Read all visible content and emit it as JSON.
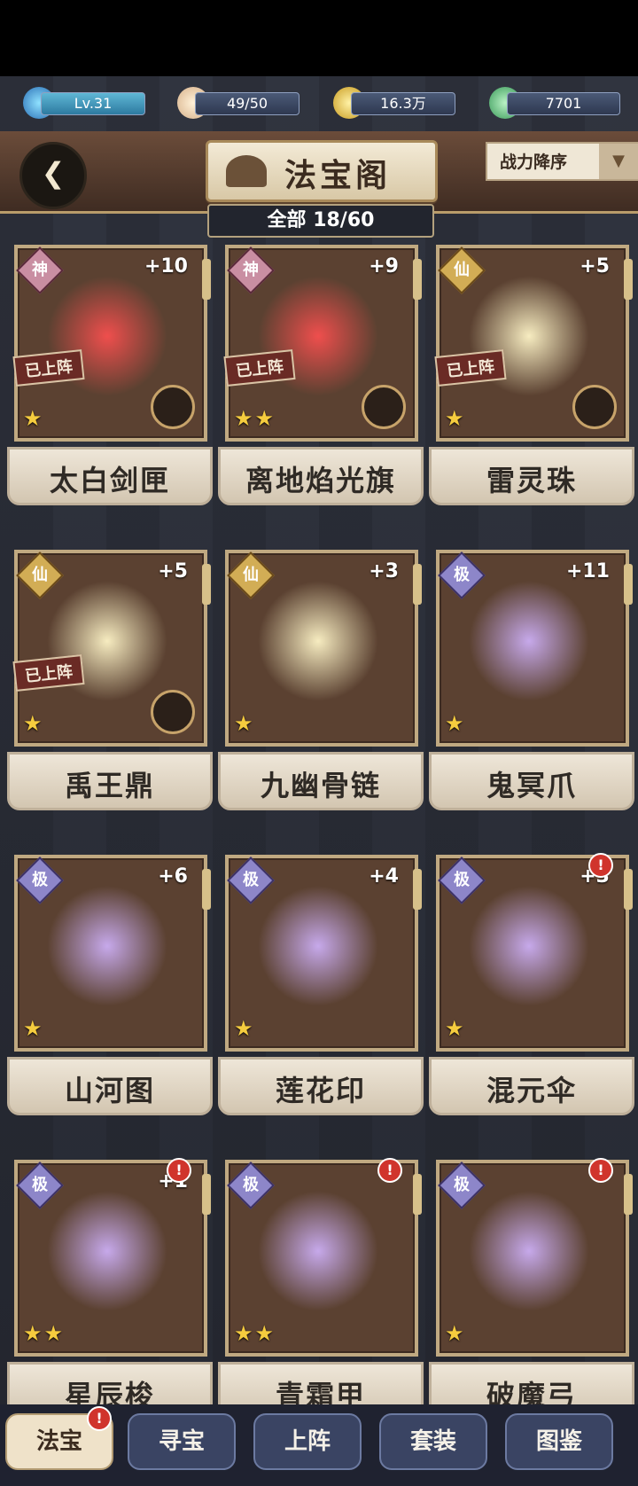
{
  "resources": {
    "level": "Lv.31",
    "stamina": "49/50",
    "coins": "16.3万",
    "jade": "7701"
  },
  "header": {
    "title": "法宝阁",
    "sort_label": "战力降序",
    "count": "全部 18/60"
  },
  "cards": [
    {
      "name": "太白剑匣",
      "rank": "神",
      "level": "+10",
      "stars": "★",
      "deployed": "已上阵",
      "glow": "red"
    },
    {
      "name": "离地焰光旗",
      "rank": "神",
      "level": "+9",
      "stars": "★★",
      "deployed": "已上阵",
      "glow": "red"
    },
    {
      "name": "雷灵珠",
      "rank": "仙",
      "level": "+5",
      "stars": "★",
      "deployed": "已上阵",
      "glow": "gold"
    },
    {
      "name": "禹王鼎",
      "rank": "仙",
      "level": "+5",
      "stars": "★",
      "deployed": "已上阵",
      "glow": "gold"
    },
    {
      "name": "九幽骨链",
      "rank": "仙",
      "level": "+3",
      "stars": "★",
      "deployed": "",
      "glow": "gold"
    },
    {
      "name": "鬼冥爪",
      "rank": "极",
      "level": "+11",
      "stars": "★",
      "deployed": "",
      "glow": "purple"
    },
    {
      "name": "山河图",
      "rank": "极",
      "level": "+6",
      "stars": "★",
      "deployed": "",
      "glow": "purple"
    },
    {
      "name": "莲花印",
      "rank": "极",
      "level": "+4",
      "stars": "★",
      "deployed": "",
      "glow": "purple"
    },
    {
      "name": "混元伞",
      "rank": "极",
      "level": "+3",
      "stars": "★",
      "deployed": "",
      "glow": "purple"
    },
    {
      "name": "星辰梭",
      "rank": "极",
      "level": "+1",
      "stars": "★★",
      "deployed": "",
      "glow": "purple"
    },
    {
      "name": "青霜甲",
      "rank": "极",
      "level": "",
      "stars": "★★",
      "deployed": "",
      "glow": "purple"
    },
    {
      "name": "破魔弓",
      "rank": "极",
      "level": "",
      "stars": "★",
      "deployed": "",
      "glow": "purple"
    }
  ],
  "tabs": {
    "t1": "法宝",
    "t2": "寻宝",
    "t3": "上阵",
    "t4": "套装",
    "t5": "图鉴"
  },
  "notice_mark": "!"
}
